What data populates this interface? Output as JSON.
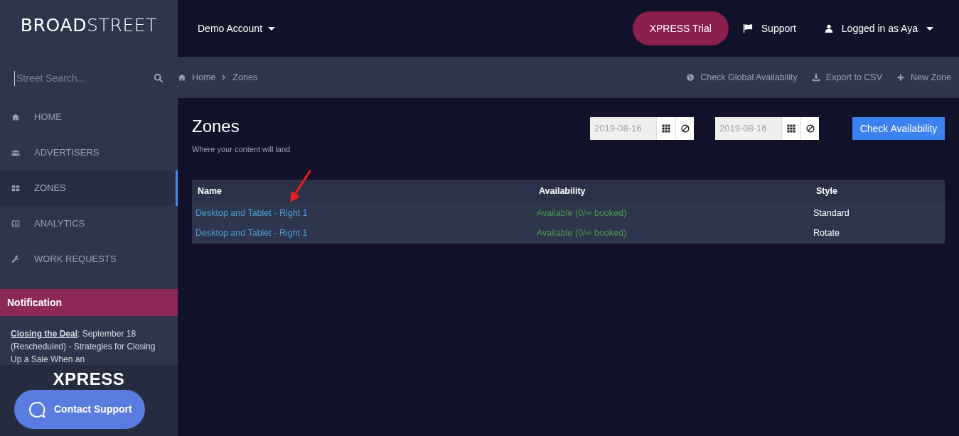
{
  "logo": "**BROAD**STREET",
  "account_menu": {
    "label": "Demo Account"
  },
  "header_actions": {
    "trial": "XPRESS Trial",
    "support": "Support",
    "user": "Logged in as Aya"
  },
  "search": {
    "placeholder": "Street Search..."
  },
  "breadcrumb": [
    "Home",
    "Zones"
  ],
  "toolbar": [
    {
      "kind": "globe",
      "label": "Check Global Availability"
    },
    {
      "kind": "download",
      "label": "Export to CSV"
    },
    {
      "kind": "plus",
      "label": "New Zone"
    }
  ],
  "sidebar": {
    "items": [
      {
        "kind": "home",
        "label": "HOME",
        "selected": false
      },
      {
        "kind": "users",
        "label": "ADVERTISERS",
        "selected": false
      },
      {
        "kind": "grid",
        "label": "ZONES",
        "selected": true
      },
      {
        "kind": "chart",
        "label": "ANALYTICS",
        "selected": false
      },
      {
        "kind": "wrench",
        "label": "WORK REQUESTS",
        "selected": false
      }
    ]
  },
  "notification": {
    "title": "Notification",
    "link": "Closing the Deal",
    "text": ": September 18 (Rescheduled) - Strategies for Closing Up a Sale When an"
  },
  "promo": "XPRESS",
  "contact_button": "Contact Support",
  "page": {
    "title": "Zones",
    "subtitle": "Where your content will land"
  },
  "date_range": [
    {
      "value": "2019-08-16"
    },
    {
      "value": "2019-08-16"
    }
  ],
  "check_button": "Check Availability",
  "table": {
    "columns": [
      "Name",
      "Availability",
      "Style"
    ],
    "rows": [
      {
        "name": "Desktop and Tablet - Right 1",
        "availability": "Available (0/∞ booked)",
        "style": "Standard"
      },
      {
        "name": "Desktop and Tablet - Right 1",
        "availability": "Available (0/∞ booked)",
        "style": "Rotate"
      }
    ]
  }
}
